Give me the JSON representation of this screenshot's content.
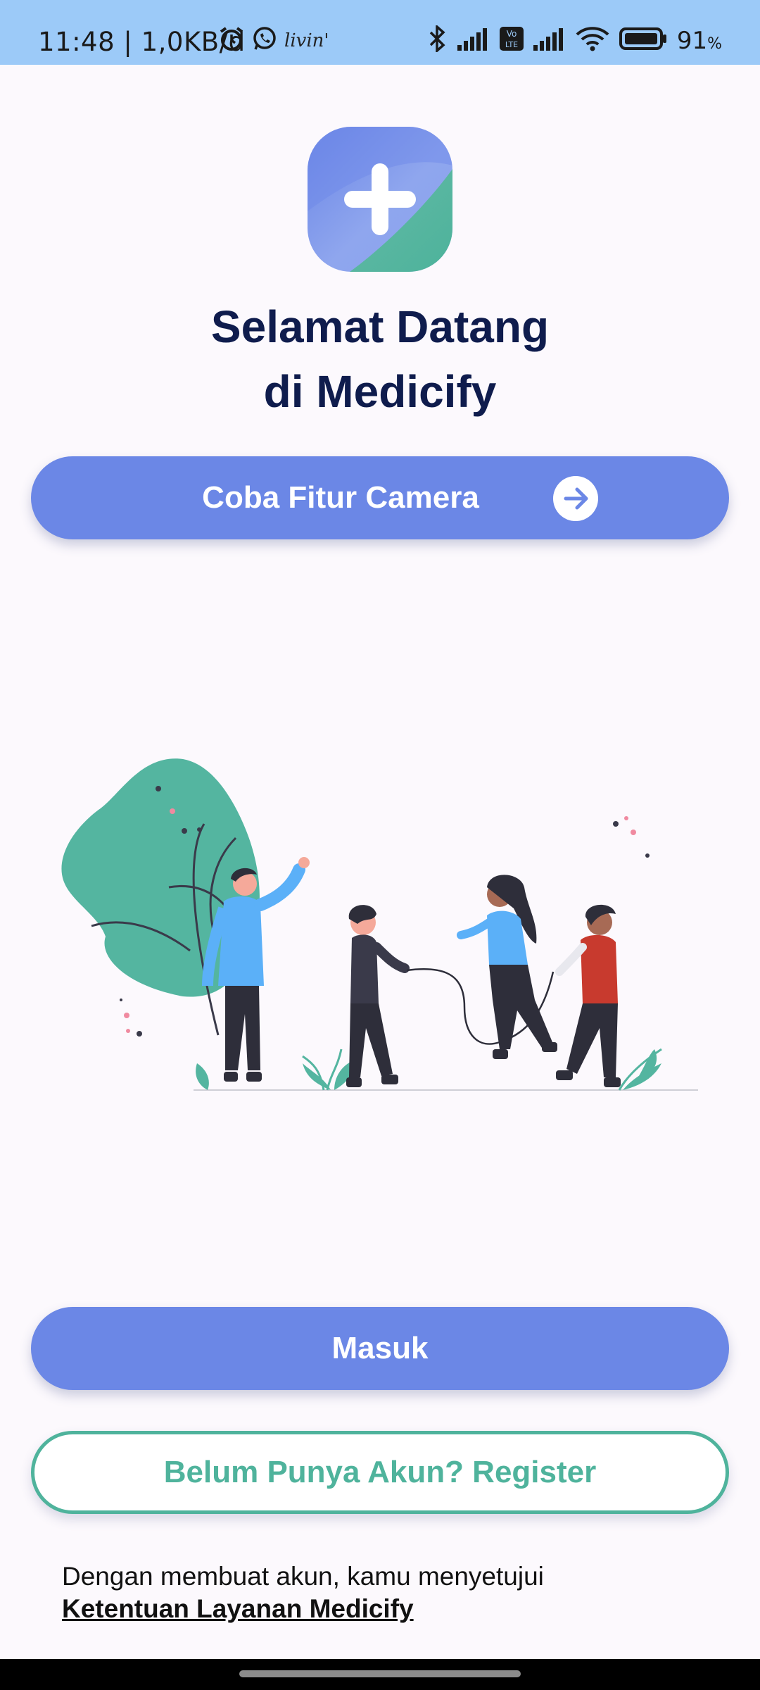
{
  "status_bar": {
    "time": "11:48 | 1,0KB/d",
    "livin": "livin'",
    "volte": "Vo LTE",
    "battery_pct": "91",
    "pct_symbol": "%",
    "icons": [
      "alarm-icon",
      "whatsapp-icon",
      "bluetooth-icon",
      "signal-icon",
      "wifi-icon",
      "battery-icon"
    ]
  },
  "welcome": {
    "title_line1": "Selamat Datang",
    "title_line2": "di Medicify"
  },
  "camera_button": {
    "label": "Coba Fitur Camera",
    "icon": "arrow-right-icon"
  },
  "login_button": {
    "label": "Masuk"
  },
  "register_button": {
    "label": "Belum Punya Akun? Register"
  },
  "terms": {
    "text": "Dengan membuat akun, kamu menyetujui",
    "link": "Ketentuan Layanan Medicify"
  },
  "colors": {
    "primary": "#6b87e6",
    "accent_green": "#4fb39c",
    "title": "#0f1c4d",
    "status_bar": "#9ccaf8"
  }
}
